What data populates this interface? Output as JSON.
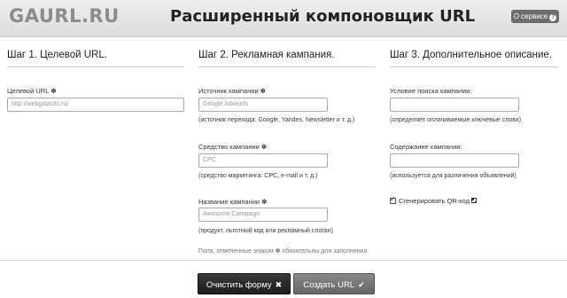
{
  "header": {
    "logo": "GAURL.RU",
    "title": "Расширенный компоновщик URL",
    "about_label": "О сервисе",
    "about_icon": "?"
  },
  "steps": [
    {
      "title": "Шаг 1. Целевой URL."
    },
    {
      "title": "Шаг 2. Рекламная кампания."
    },
    {
      "title": "Шаг 3. Дополнительное описание."
    }
  ],
  "required_mark": "✽",
  "fields": {
    "target_url": {
      "label": "Целевой URL",
      "placeholder": "http://webgalactic.ru/"
    },
    "source": {
      "label": "Источник кампании",
      "placeholder": "Google Adwords",
      "hint": "(источник перехода: Google, Yandex, Newsletter и т. д.)"
    },
    "medium": {
      "label": "Средство кампании",
      "placeholder": "CPC",
      "hint": "(средство маркетинга: CPC, e-mail и т. д.)"
    },
    "name": {
      "label": "Название кампании",
      "placeholder": "Awesome Campaign",
      "hint": "(продукт, льготный код или рекламный слоган)"
    },
    "term": {
      "label": "Условие поиска кампании:",
      "hint": "(определяет оплачиваемые ключевые слова)"
    },
    "content": {
      "label": "Содержание кампании:",
      "hint": "(используется для различения объявлений)"
    }
  },
  "qr_checkbox": {
    "label": "Сгенерировать QR-код",
    "checked": true
  },
  "footnote": "Поля, отмеченные знаком ✽ обязательны для заполнения.",
  "buttons": {
    "clear": {
      "label": "Очистить форму",
      "icon": "✖"
    },
    "create": {
      "label": "Создать URL",
      "icon": "✔"
    }
  }
}
